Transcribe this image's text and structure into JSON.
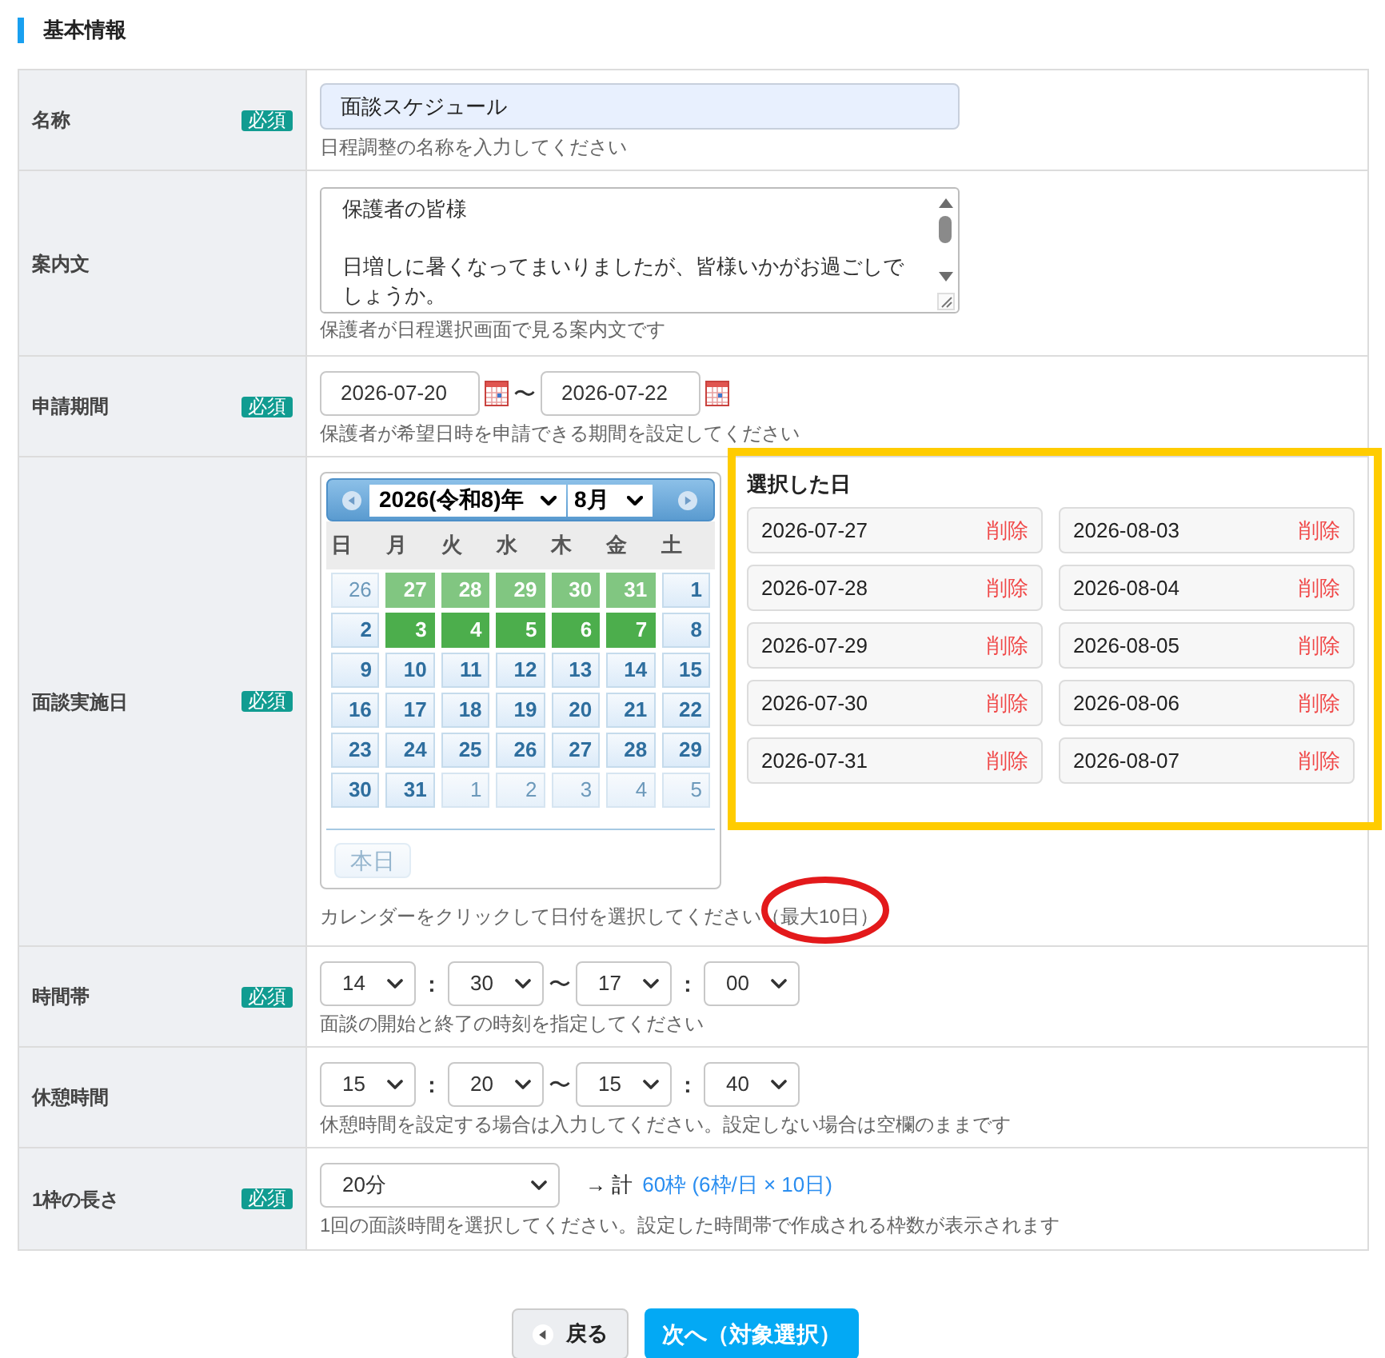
{
  "section": {
    "title": "基本情報"
  },
  "rows": [
    {
      "kind": "text",
      "label": "名称",
      "badge": "必須",
      "value": "面談スケジュール",
      "hint": "日程調整の名称を入力してください"
    },
    {
      "kind": "textarea",
      "label": "案内文",
      "paragraphs": [
        "保護者の皆様",
        "日増しに暑くなってまいりましたが、皆様いかがお過ごしでしょうか。"
      ],
      "hint": "保護者が日程選択画面で見る案内文です"
    },
    {
      "kind": "date_range",
      "label": "申請期間",
      "badge": "必須",
      "start": "2026-07-20",
      "separator": "〜",
      "end": "2026-07-22",
      "hint": "保護者が希望日時を申請できる期間を設定してください"
    },
    {
      "kind": "calendar",
      "label": "面談実施日",
      "badge": "必須",
      "calendar": {
        "year": "2026(令和8)年",
        "month": "8月",
        "weekdays": [
          "日",
          "月",
          "火",
          "水",
          "木",
          "金",
          "土"
        ],
        "weeks": [
          [
            {
              "day": "26",
              "other_month": true,
              "selected": false
            },
            {
              "day": "27",
              "other_month": true,
              "selected": true
            },
            {
              "day": "28",
              "other_month": true,
              "selected": true
            },
            {
              "day": "29",
              "other_month": true,
              "selected": true
            },
            {
              "day": "30",
              "other_month": true,
              "selected": true
            },
            {
              "day": "31",
              "other_month": true,
              "selected": true
            },
            {
              "day": "1",
              "other_month": false,
              "selected": false
            }
          ],
          [
            {
              "day": "2",
              "other_month": false,
              "selected": false
            },
            {
              "day": "3",
              "other_month": false,
              "selected": true
            },
            {
              "day": "4",
              "other_month": false,
              "selected": true
            },
            {
              "day": "5",
              "other_month": false,
              "selected": true
            },
            {
              "day": "6",
              "other_month": false,
              "selected": true
            },
            {
              "day": "7",
              "other_month": false,
              "selected": true
            },
            {
              "day": "8",
              "other_month": false,
              "selected": false
            }
          ],
          [
            {
              "day": "9",
              "other_month": false,
              "selected": false
            },
            {
              "day": "10",
              "other_month": false,
              "selected": false
            },
            {
              "day": "11",
              "other_month": false,
              "selected": false
            },
            {
              "day": "12",
              "other_month": false,
              "selected": false
            },
            {
              "day": "13",
              "other_month": false,
              "selected": false
            },
            {
              "day": "14",
              "other_month": false,
              "selected": false
            },
            {
              "day": "15",
              "other_month": false,
              "selected": false
            }
          ],
          [
            {
              "day": "16",
              "other_month": false,
              "selected": false
            },
            {
              "day": "17",
              "other_month": false,
              "selected": false
            },
            {
              "day": "18",
              "other_month": false,
              "selected": false
            },
            {
              "day": "19",
              "other_month": false,
              "selected": false
            },
            {
              "day": "20",
              "other_month": false,
              "selected": false
            },
            {
              "day": "21",
              "other_month": false,
              "selected": false
            },
            {
              "day": "22",
              "other_month": false,
              "selected": false
            }
          ],
          [
            {
              "day": "23",
              "other_month": false,
              "selected": false
            },
            {
              "day": "24",
              "other_month": false,
              "selected": false
            },
            {
              "day": "25",
              "other_month": false,
              "selected": false
            },
            {
              "day": "26",
              "other_month": false,
              "selected": false
            },
            {
              "day": "27",
              "other_month": false,
              "selected": false
            },
            {
              "day": "28",
              "other_month": false,
              "selected": false
            },
            {
              "day": "29",
              "other_month": false,
              "selected": false
            }
          ],
          [
            {
              "day": "30",
              "other_month": false,
              "selected": false
            },
            {
              "day": "31",
              "other_month": false,
              "selected": false
            },
            {
              "day": "1",
              "other_month": true,
              "selected": false
            },
            {
              "day": "2",
              "other_month": true,
              "selected": false
            },
            {
              "day": "3",
              "other_month": true,
              "selected": false
            },
            {
              "day": "4",
              "other_month": true,
              "selected": false
            },
            {
              "day": "5",
              "other_month": true,
              "selected": false
            }
          ]
        ],
        "today_button": {
          "label": "本日",
          "disabled": true
        }
      },
      "selected_days": {
        "title": "選択した日",
        "items": [
          {
            "date": "2026-07-27",
            "action": "削除"
          },
          {
            "date": "2026-07-28",
            "action": "削除"
          },
          {
            "date": "2026-07-29",
            "action": "削除"
          },
          {
            "date": "2026-07-30",
            "action": "削除"
          },
          {
            "date": "2026-07-31",
            "action": "削除"
          },
          {
            "date": "2026-08-03",
            "action": "削除"
          },
          {
            "date": "2026-08-04",
            "action": "削除"
          },
          {
            "date": "2026-08-05",
            "action": "削除"
          },
          {
            "date": "2026-08-06",
            "action": "削除"
          },
          {
            "date": "2026-08-07",
            "action": "削除"
          }
        ]
      },
      "hint": "カレンダーをクリックして日付を選択してください",
      "note": "（最大10日）"
    },
    {
      "kind": "time_range",
      "label": "時間帯",
      "badge": "必須",
      "start": {
        "hour": "14",
        "colon": ":",
        "minute": "30"
      },
      "separator": "〜",
      "end": {
        "hour": "17",
        "colon": ":",
        "minute": "00"
      },
      "hint": "面談の開始と終了の時刻を指定してください"
    },
    {
      "kind": "time_range",
      "label": "休憩時間",
      "start": {
        "hour": "15",
        "colon": ":",
        "minute": "20"
      },
      "separator": "〜",
      "end": {
        "hour": "15",
        "colon": ":",
        "minute": "40"
      },
      "hint": "休憩時間を設定する場合は入力してください。設定しない場合は空欄のままです"
    },
    {
      "kind": "duration",
      "label": "1枠の長さ",
      "badge": "必須",
      "value": "20分",
      "total_prefix": "→ 計",
      "total": "60枠 (6枠/日 × 10日)",
      "hint": "1回の面談時間を選択してください。設定した時間帯で作成される枠数が表示されます"
    }
  ],
  "buttons": [
    {
      "kind": "back",
      "label": "戻る"
    },
    {
      "kind": "primary",
      "label": "次へ（対象選択）"
    }
  ]
}
